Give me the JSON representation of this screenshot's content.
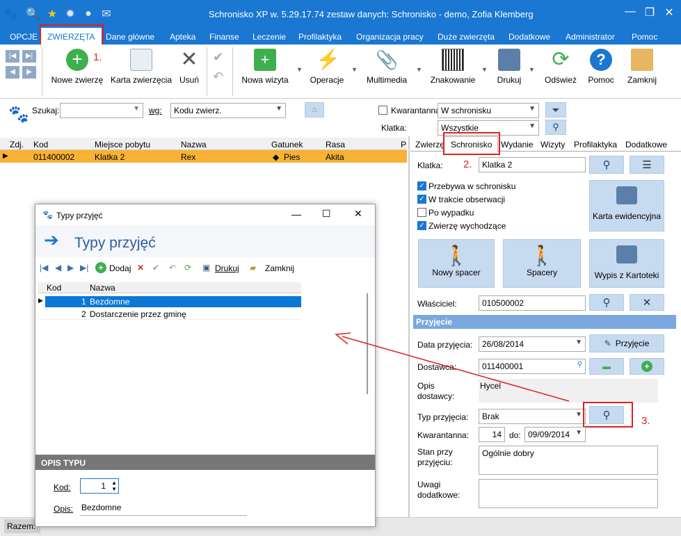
{
  "title": "Schronisko XP w. 5.29.17.74 zestaw danych: Schronisko - demo, Zofia Klemberg",
  "menu": [
    "OPCJE",
    "ZWIERZĘTA",
    "Dane główne",
    "Apteka",
    "Finanse",
    "Leczenie",
    "Profilaktyka",
    "Organizacja pracy",
    "Duże zwierzęta",
    "Dodatkowe",
    "Administrator",
    "Pomoc"
  ],
  "annotations": {
    "a1": "1.",
    "a2": "2.",
    "a3": "3."
  },
  "toolbar": {
    "nowe_zwierze": "Nowe zwierzę",
    "karta_zwierzecia": "Karta zwierzęcia",
    "usun": "Usuń",
    "nowa_wizyta": "Nowa wizyta",
    "operacje": "Operacje",
    "multimedia": "Multimedia",
    "znakowanie": "Znakowanie",
    "drukuj": "Drukuj",
    "odswiez": "Odśwież",
    "pomoc": "Pomoc",
    "zamknij": "Zamknij"
  },
  "search": {
    "label": "Szukaj:",
    "wg": "wg:",
    "wg_value": "Kodu zwierz.",
    "kwarantanna": "Kwarantanna",
    "status_value": "W schronisku",
    "klatka_label": "Klatka:",
    "klatka_value": "Wszystkie"
  },
  "grid": {
    "headers": [
      "Zdj.",
      "Kod",
      "Miejsce pobytu",
      "Nazwa",
      "Gatunek",
      "Rasa",
      "P"
    ],
    "row": {
      "kod": "011400002",
      "miejsce": "Klatka 2",
      "nazwa": "Rex",
      "gatunek": "Pies",
      "rasa": "Akita"
    }
  },
  "tabs": [
    "Zwierzę",
    "Schronisko",
    "Wydanie",
    "Wizyty",
    "Profilaktyka",
    "Dodatkowe"
  ],
  "schronisko": {
    "klatka_label": "Klatka:",
    "klatka_value": "Klatka 2",
    "checks": [
      {
        "label": "Przebywa w schronisku",
        "on": true
      },
      {
        "label": "W trakcie obserwacji",
        "on": true
      },
      {
        "label": "Po wypadku",
        "on": false
      },
      {
        "label": "Zwierzę wychodzące",
        "on": true
      }
    ],
    "karta_ewid": "Karta ewidencyjna",
    "nowy_spacer": "Nowy spacer",
    "spacery": "Spacery",
    "wypis": "Wypis z Kartoteki",
    "wlasciciel_label": "Właściciel:",
    "wlasciciel_value": "010500002"
  },
  "przyjecie": {
    "section": "Przyjęcie",
    "data_label": "Data przyjęcia:",
    "data_value": "26/08/2014",
    "przyjecie_btn": "Przyjęcie",
    "dostawca_label": "Dostawca:",
    "dostawca_value": "011400001",
    "opis_label": "Opis dostawcy:",
    "opis_value": "Hycel",
    "typ_label": "Typ przyjęcia:",
    "typ_value": "Brak",
    "kwarantanna_label": "Kwarantanna:",
    "kwarantanna_value": "14",
    "do_label": "do:",
    "do_value": "09/09/2014",
    "stan_label": "Stan przy przyjęciu:",
    "stan_value": "Ogólnie dobry",
    "uwagi_label": "Uwagi dodatkowe:"
  },
  "dialog": {
    "title": "Typy przyjęć",
    "header": "Typy przyjęć",
    "dodaj": "Dodaj",
    "drukuj": "Drukuj",
    "zamknij": "Zamknij",
    "cols": [
      "Kod",
      "Nazwa"
    ],
    "rows": [
      {
        "kod": "1",
        "nazwa": "Bezdomne"
      },
      {
        "kod": "2",
        "nazwa": "Dostarczenie przez gminę"
      }
    ],
    "opis_typu": "OPIS TYPU",
    "kod_label": "Kod:",
    "kod_value": "1",
    "opis_label": "Opis:",
    "opis_value": "Bezdomne"
  },
  "bottom": {
    "razem": "Razem:"
  },
  "colors": {
    "accent": "#1a77d2",
    "selected_row": "#f9b233",
    "annotation": "#e02020"
  }
}
